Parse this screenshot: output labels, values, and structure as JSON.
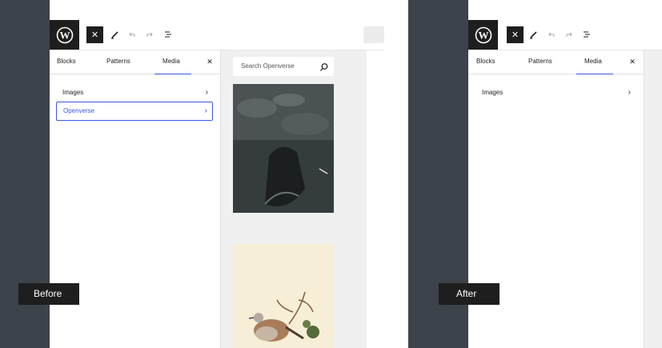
{
  "before": {
    "badge": "Before",
    "tabs": [
      "Blocks",
      "Patterns",
      "Media"
    ],
    "categories": [
      {
        "label": "Images",
        "selected": false
      },
      {
        "label": "Openverse",
        "selected": true
      }
    ],
    "search_placeholder": "Search Openverse"
  },
  "after": {
    "badge": "After",
    "tabs": [
      "Blocks",
      "Patterns",
      "Media"
    ],
    "categories": [
      {
        "label": "Images",
        "selected": false
      }
    ]
  },
  "icons": {
    "logo": "wordpress-logo-icon",
    "close": "close-icon",
    "pencil": "pencil-icon",
    "undo": "undo-icon",
    "redo": "redo-icon",
    "list": "list-view-icon",
    "chevron": "chevron-right-icon",
    "search": "search-icon"
  },
  "colors": {
    "accent": "#3858e9",
    "dark": "#1e1e1e",
    "backdrop": "#3c434a"
  }
}
